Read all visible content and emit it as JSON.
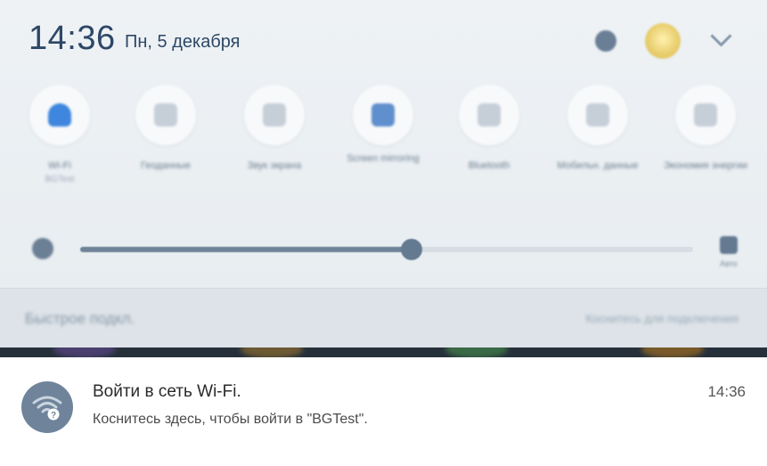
{
  "status": {
    "time": "14:36",
    "date": "Пн, 5 декабря"
  },
  "header_icons": [
    "gear-icon",
    "avatar",
    "chevron-down-icon"
  ],
  "quick_settings": [
    {
      "id": "wifi",
      "label": "Wi-Fi",
      "sub": "BGTest",
      "icon": "wifi-icon",
      "active": true
    },
    {
      "id": "location",
      "label": "Геоданные",
      "sub": "",
      "icon": "location-icon",
      "active": false
    },
    {
      "id": "share",
      "label": "Звук экрана",
      "sub": "",
      "icon": "share-icon",
      "active": false
    },
    {
      "id": "screen",
      "label": "Screen mirroring",
      "sub": "",
      "icon": "cast-icon",
      "active": false
    },
    {
      "id": "bluetooth",
      "label": "Bluetooth",
      "sub": "",
      "icon": "bluetooth-icon",
      "active": false
    },
    {
      "id": "mobile-data",
      "label": "Мобильн. данные",
      "sub": "",
      "icon": "mobile-data-icon",
      "active": false
    },
    {
      "id": "power",
      "label": "Экономия энергии",
      "sub": "",
      "icon": "battery-icon",
      "active": false
    }
  ],
  "brightness": {
    "level": 0.54,
    "auto_label": "Авто"
  },
  "quick_connect": {
    "left": "Быстрое подкл.",
    "right": "Коснитесь для подключения"
  },
  "notification": {
    "title": "Войти в сеть Wi-Fi.",
    "text": "Коснитесь здесь, чтобы войти в \"BGTest\".",
    "time": "14:36",
    "icon": "wifi-question-icon"
  },
  "colors": {
    "accent": "#3e86de",
    "notification_icon_bg": "#6f849a",
    "clock": "#2d4766"
  }
}
